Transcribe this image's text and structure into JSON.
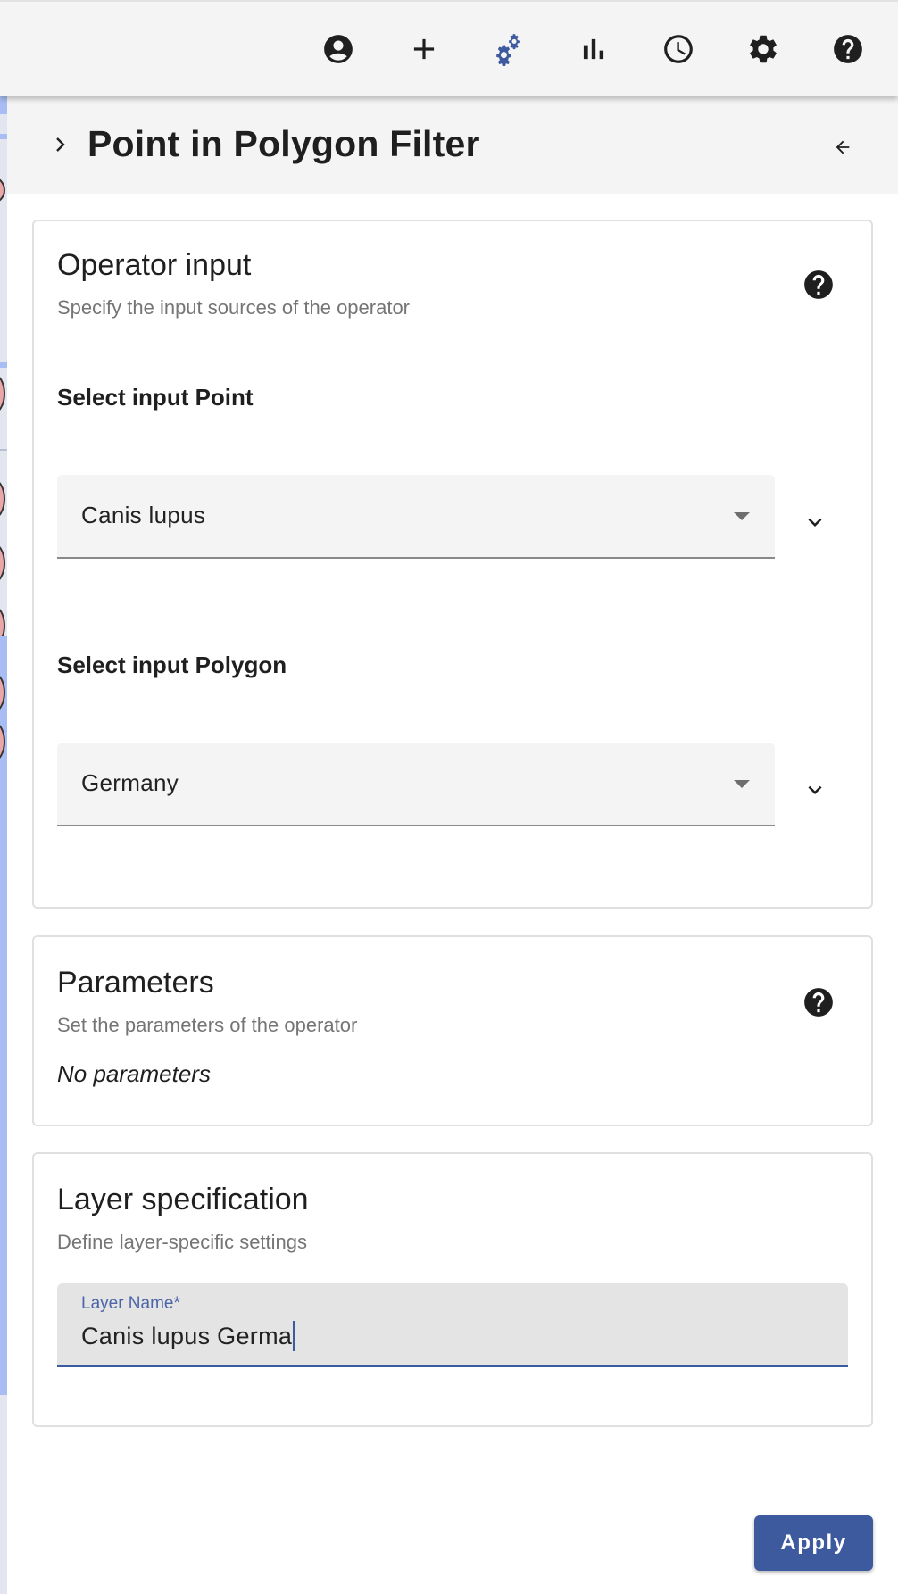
{
  "toolbar": {
    "icons": [
      {
        "name": "account-icon",
        "label": "Account"
      },
      {
        "name": "add-icon",
        "label": "Add data"
      },
      {
        "name": "operators-icon",
        "label": "Operators",
        "active": true
      },
      {
        "name": "plots-icon",
        "label": "Plots"
      },
      {
        "name": "time-icon",
        "label": "Time"
      },
      {
        "name": "settings-icon",
        "label": "Settings"
      },
      {
        "name": "help-icon",
        "label": "Help"
      }
    ],
    "active_color": "#3e5a9f",
    "icon_color": "#1f1f1f"
  },
  "panel": {
    "title": "Point in Polygon Filter"
  },
  "operator_input": {
    "title": "Operator input",
    "subtitle": "Specify the input sources of the operator",
    "point": {
      "label": "Select input Point",
      "value": "Canis lupus"
    },
    "polygon": {
      "label": "Select input Polygon",
      "value": "Germany"
    }
  },
  "parameters": {
    "title": "Parameters",
    "subtitle": "Set the parameters of the operator",
    "empty_text": "No parameters"
  },
  "layer_spec": {
    "title": "Layer specification",
    "subtitle": "Define layer-specific settings",
    "layer_name": {
      "label": "Layer Name*",
      "value": "Canis lupus Germa"
    }
  },
  "actions": {
    "apply_label": "Apply"
  },
  "colors": {
    "accent": "#3e5a9f",
    "header_bg": "#f4f4f4",
    "muted_text": "#757575"
  }
}
